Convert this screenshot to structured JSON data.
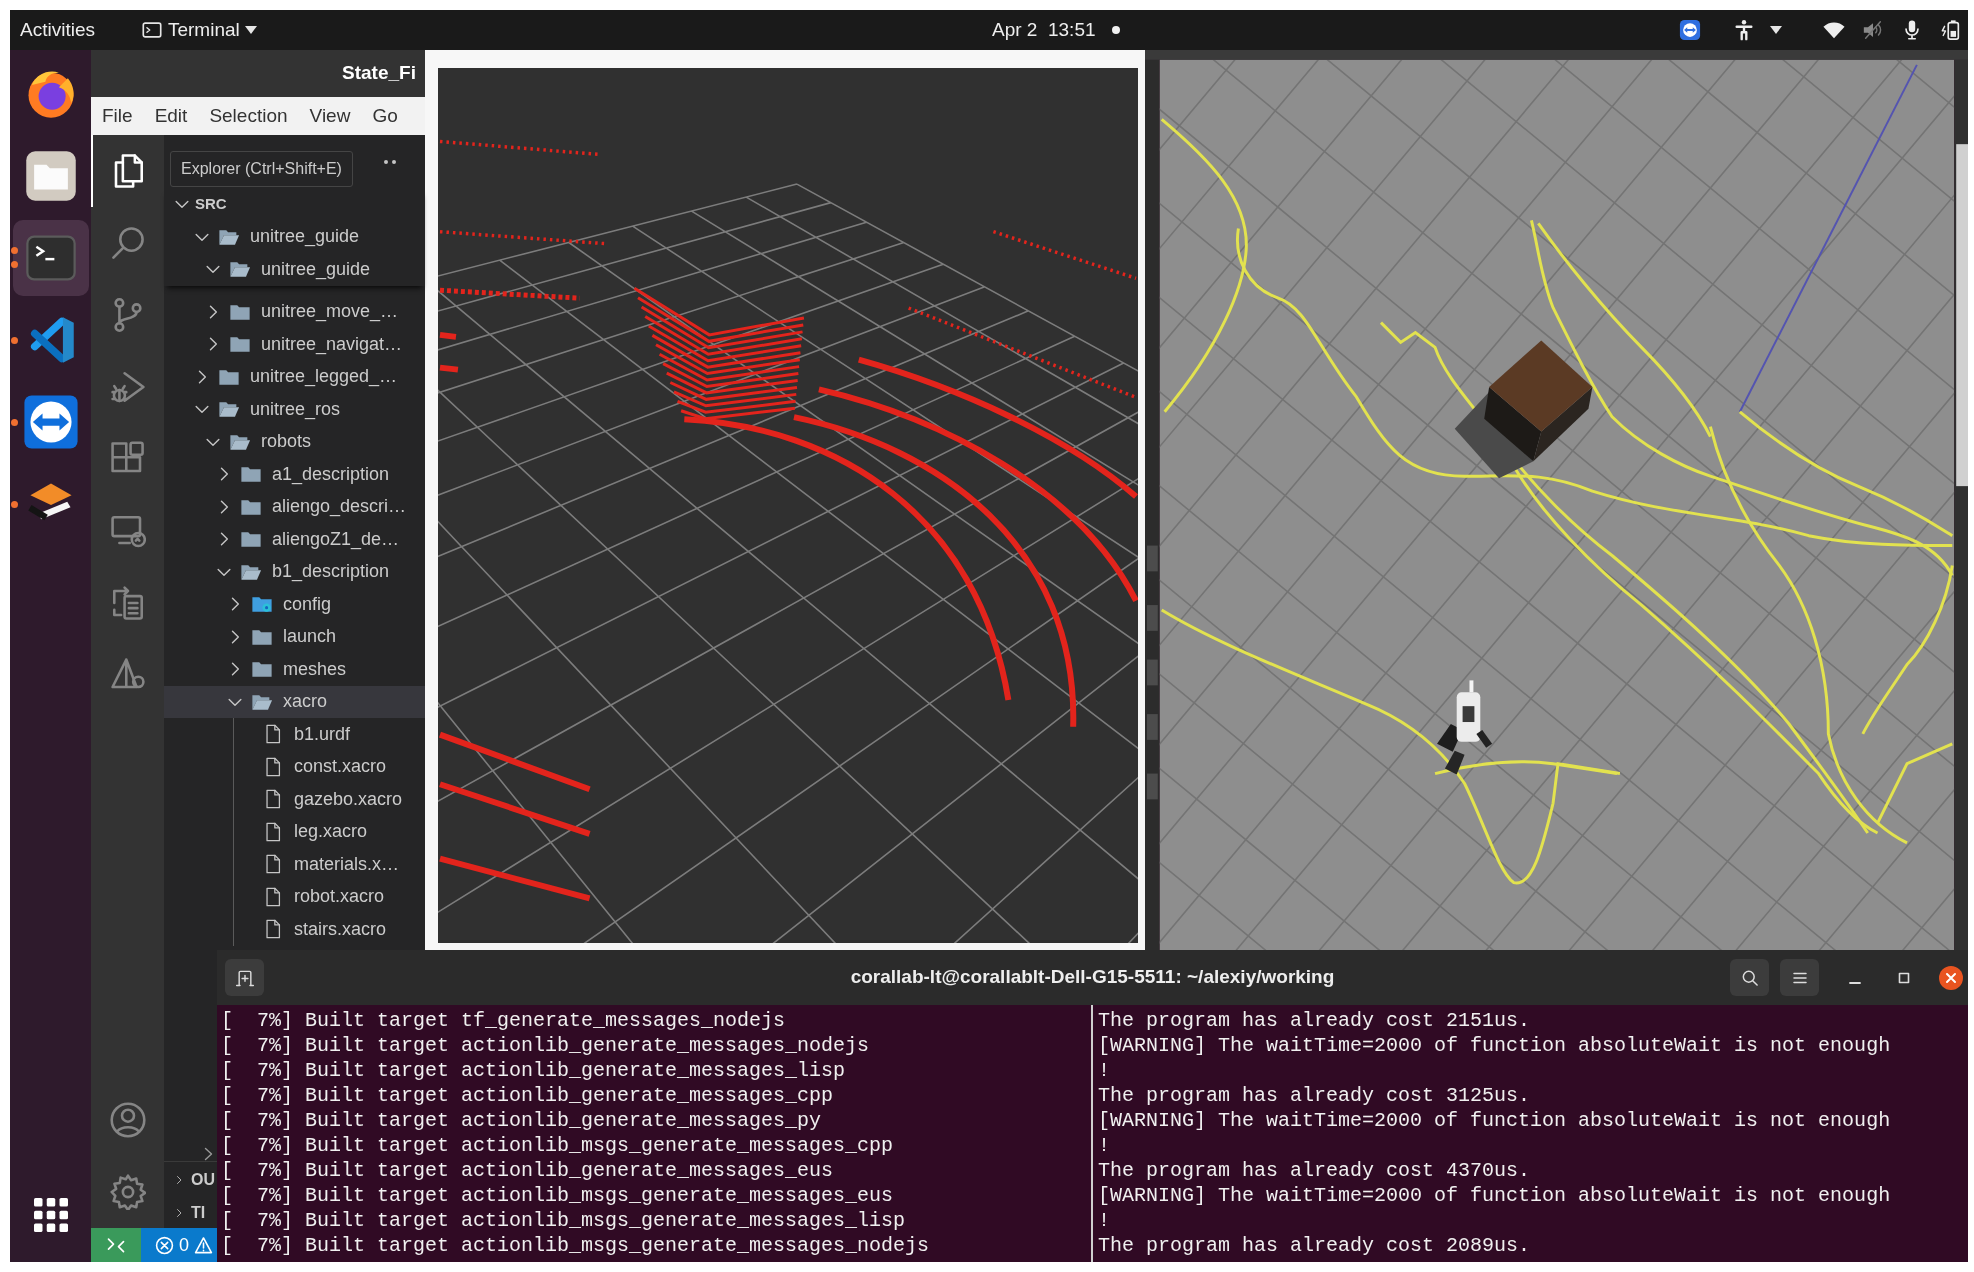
{
  "top_bar": {
    "activities": "Activities",
    "app_menu": "Terminal",
    "clock": "Apr 2  13:51"
  },
  "dock": {
    "apps": [
      {
        "kind": "browser",
        "running": false,
        "multiple_windows": false,
        "selected": false
      },
      {
        "kind": "files",
        "running": false,
        "multiple_windows": false,
        "selected": false
      },
      {
        "kind": "terminal",
        "running": true,
        "multiple_windows": true,
        "selected": true
      },
      {
        "kind": "editor",
        "running": true,
        "multiple_windows": false,
        "selected": false
      },
      {
        "kind": "remote",
        "running": true,
        "multiple_windows": false,
        "selected": false
      },
      {
        "kind": "layers",
        "running": true,
        "multiple_windows": false,
        "selected": false
      }
    ]
  },
  "editor": {
    "title": "State_Fi",
    "menu": [
      "File",
      "Edit",
      "Selection",
      "View",
      "Go"
    ],
    "activity_bar": [
      {
        "kind": "files",
        "selected": true
      },
      {
        "kind": "search",
        "selected": false
      },
      {
        "kind": "branch",
        "selected": false
      },
      {
        "kind": "debug",
        "selected": false
      },
      {
        "kind": "extensions",
        "selected": false
      },
      {
        "kind": "remote",
        "selected": false
      },
      {
        "kind": "documents",
        "selected": false
      },
      {
        "kind": "pyramid",
        "selected": false
      }
    ],
    "activity_bar_bottom": [
      {
        "kind": "account"
      },
      {
        "kind": "settings"
      }
    ],
    "tooltip": "Explorer (Ctrl+Shift+E)",
    "tree": [
      {
        "label": "SRC",
        "kind": "root",
        "expanded": true,
        "selected": false,
        "sticky": true,
        "children": [
          {
            "label": "unitree_guide",
            "kind": "folder",
            "expanded": true,
            "selected": false,
            "sticky": true,
            "children": [
              {
                "label": "unitree_guide",
                "kind": "folder",
                "expanded": true,
                "selected": false,
                "sticky": true
              },
              {
                "label": "unitree_move_…",
                "kind": "folder",
                "expanded": false,
                "selected": false,
                "sticky": false
              },
              {
                "label": "unitree_navigat…",
                "kind": "folder",
                "expanded": false,
                "selected": false,
                "sticky": false
              }
            ]
          },
          {
            "label": "unitree_legged_…",
            "kind": "folder",
            "expanded": false,
            "selected": false,
            "sticky": false
          },
          {
            "label": "unitree_ros",
            "kind": "folder",
            "expanded": true,
            "selected": false,
            "sticky": false,
            "children": [
              {
                "label": "robots",
                "kind": "folder",
                "expanded": true,
                "selected": false,
                "sticky": false,
                "children": [
                  {
                    "label": "a1_description",
                    "kind": "folder",
                    "expanded": false,
                    "selected": false,
                    "sticky": false
                  },
                  {
                    "label": "aliengo_descri…",
                    "kind": "folder",
                    "expanded": false,
                    "selected": false,
                    "sticky": false
                  },
                  {
                    "label": "aliengoZ1_de…",
                    "kind": "folder",
                    "expanded": false,
                    "selected": false,
                    "sticky": false
                  },
                  {
                    "label": "b1_description",
                    "kind": "folder",
                    "expanded": true,
                    "selected": false,
                    "sticky": false,
                    "children": [
                      {
                        "label": "config",
                        "kind": "config-folder",
                        "expanded": false,
                        "selected": false,
                        "sticky": false
                      },
                      {
                        "label": "launch",
                        "kind": "folder",
                        "expanded": false,
                        "selected": false,
                        "sticky": false
                      },
                      {
                        "label": "meshes",
                        "kind": "folder",
                        "expanded": false,
                        "selected": false,
                        "sticky": false
                      },
                      {
                        "label": "xacro",
                        "kind": "folder",
                        "expanded": true,
                        "selected": true,
                        "sticky": false,
                        "children": [
                          {
                            "label": "b1.urdf",
                            "kind": "file",
                            "selected": false,
                            "sticky": false
                          },
                          {
                            "label": "const.xacro",
                            "kind": "file",
                            "selected": false,
                            "sticky": false
                          },
                          {
                            "label": "gazebo.xacro",
                            "kind": "file",
                            "selected": false,
                            "sticky": false
                          },
                          {
                            "label": "leg.xacro",
                            "kind": "file",
                            "selected": false,
                            "sticky": false
                          },
                          {
                            "label": "materials.x…",
                            "kind": "file",
                            "selected": false,
                            "sticky": false
                          },
                          {
                            "label": "robot.xacro",
                            "kind": "file",
                            "selected": false,
                            "sticky": false
                          },
                          {
                            "label": "stairs.xacro",
                            "kind": "file",
                            "selected": false,
                            "sticky": false
                          }
                        ]
                      }
                    ]
                  }
                ]
              }
            ]
          }
        ]
      }
    ],
    "panels": [
      {
        "label": "OU",
        "expanded": false
      },
      {
        "label": "TI",
        "expanded": false
      }
    ],
    "status_bar": {
      "errors": "0"
    }
  },
  "terminal": {
    "title": "corallab-lt@corallablt-Dell-G15-5511: ~/alexiy/working",
    "panes": [
      {
        "lines": [
          "[  7%] Built target tf_generate_messages_nodejs",
          "[  7%] Built target actionlib_generate_messages_nodejs",
          "[  7%] Built target actionlib_generate_messages_lisp",
          "[  7%] Built target actionlib_generate_messages_cpp",
          "[  7%] Built target actionlib_generate_messages_py",
          "[  7%] Built target actionlib_msgs_generate_messages_cpp",
          "[  7%] Built target actionlib_generate_messages_eus",
          "[  7%] Built target actionlib_msgs_generate_messages_eus",
          "[  7%] Built target actionlib_msgs_generate_messages_lisp",
          "[  7%] Built target actionlib_msgs_generate_messages_nodejs"
        ]
      },
      {
        "lines": [
          "The program has already cost 2151us.",
          "[WARNING] The waitTime=2000 of function absoluteWait is not enough",
          "!",
          "The program has already cost 3125us.",
          "[WARNING] The waitTime=2000 of function absoluteWait is not enough",
          "!",
          "The program has already cost 4370us.",
          "[WARNING] The waitTime=2000 of function absoluteWait is not enough",
          "!",
          "The program has already cost 2089us."
        ]
      }
    ]
  }
}
